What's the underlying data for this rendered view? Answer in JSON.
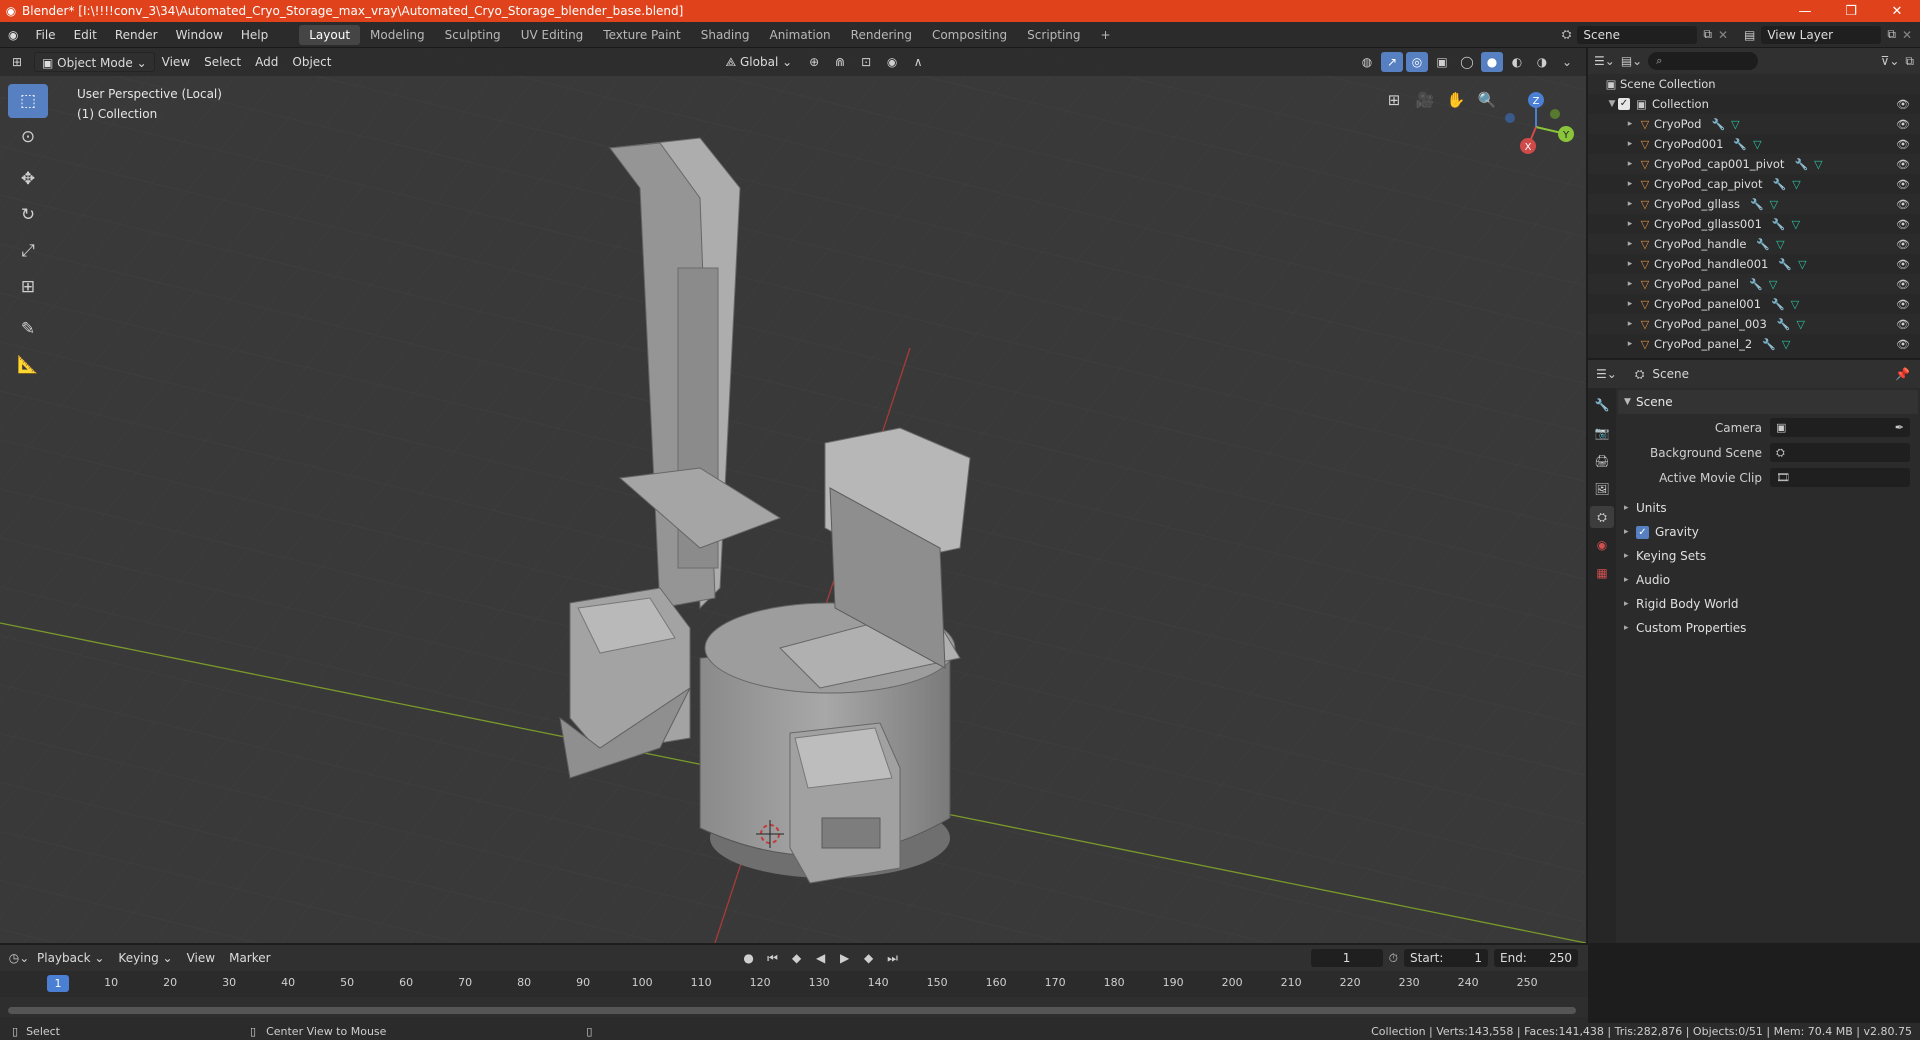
{
  "window": {
    "title": "Blender* [I:\\!!!!conv_3\\34\\Automated_Cryo_Storage_max_vray\\Automated_Cryo_Storage_blender_base.blend]",
    "controls": [
      "—",
      "❐",
      "✕"
    ]
  },
  "menu": [
    "File",
    "Edit",
    "Render",
    "Window",
    "Help"
  ],
  "workspaces": [
    "Layout",
    "Modeling",
    "Sculpting",
    "UV Editing",
    "Texture Paint",
    "Shading",
    "Animation",
    "Rendering",
    "Compositing",
    "Scripting"
  ],
  "active_workspace": "Layout",
  "scene_field": "Scene",
  "view_layer_field": "View Layer",
  "viewport": {
    "mode": "Object Mode",
    "menus": [
      "View",
      "Select",
      "Add",
      "Object"
    ],
    "transform": "Global",
    "info_line1": "User Perspective (Local)",
    "info_line2": "(1) Collection",
    "gizmo": {
      "x": "X",
      "y": "Y",
      "z": "Z"
    }
  },
  "outliner": {
    "root": "Scene Collection",
    "collection": "Collection",
    "items": [
      "CryoPod",
      "CryoPod001",
      "CryoPod_cap001_pivot",
      "CryoPod_cap_pivot",
      "CryoPod_gllass",
      "CryoPod_gllass001",
      "CryoPod_handle",
      "CryoPod_handle001",
      "CryoPod_panel",
      "CryoPod_panel001",
      "CryoPod_panel_003",
      "CryoPod_panel_2"
    ]
  },
  "properties": {
    "context": "Scene",
    "panel": "Scene",
    "fields": [
      {
        "label": "Camera"
      },
      {
        "label": "Background Scene"
      },
      {
        "label": "Active Movie Clip"
      }
    ],
    "subpanels": [
      "Units",
      "Gravity",
      "Keying Sets",
      "Audio",
      "Rigid Body World",
      "Custom Properties"
    ]
  },
  "timeline": {
    "menus": [
      "Playback",
      "Keying",
      "View",
      "Marker"
    ],
    "current_frame": "1",
    "start_label": "Start:",
    "start": "1",
    "end_label": "End:",
    "end": "250",
    "ticks": [
      "10",
      "20",
      "30",
      "40",
      "50",
      "60",
      "70",
      "80",
      "90",
      "100",
      "110",
      "120",
      "130",
      "140",
      "150",
      "160",
      "170",
      "180",
      "190",
      "200",
      "210",
      "220",
      "230",
      "240",
      "250"
    ],
    "marker": "1"
  },
  "status": {
    "left": "Select",
    "middle": "Center View to Mouse",
    "right": "Collection | Verts:143,558 | Faces:141,438 | Tris:282,876 | Objects:0/51 | Mem: 70.4 MB | v2.80.75"
  },
  "colors": {
    "titlebar": "#e0431c",
    "accent": "#5680c2",
    "object": "#e3923f",
    "mesh": "#2ec4a0"
  }
}
